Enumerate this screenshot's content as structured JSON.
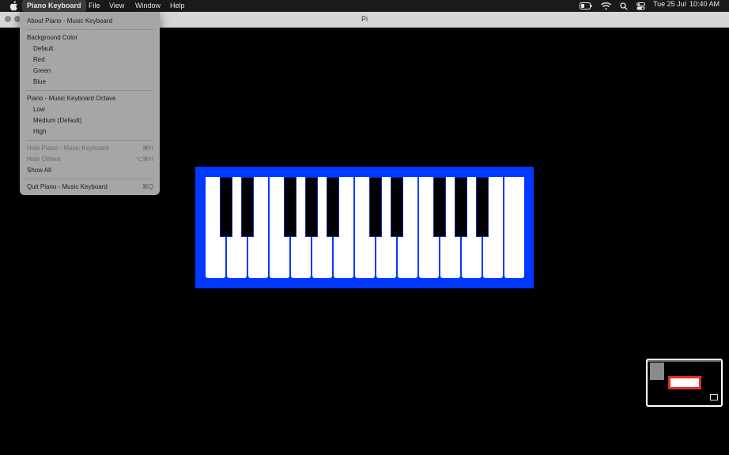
{
  "menubar": {
    "app_name": "Piano Keyboard",
    "items": [
      "File",
      "View",
      "Window",
      "Help"
    ],
    "date": "Tue 25 Jul",
    "time": "10:40 AM"
  },
  "window": {
    "title": "Pi"
  },
  "app_menu": {
    "about": "About Piano - Music Keyboard",
    "bg_header": "Background Color",
    "bg_options": [
      "Default",
      "Red",
      "Green",
      "Blue"
    ],
    "octave_header": "Piano - Music Keyboard Octave",
    "octave_options": [
      "Low",
      "Medium (Default)",
      "High"
    ],
    "hide_app": "Hide Piano - Music Keyboard",
    "hide_app_shortcut": "⌘H",
    "hide_others": "Hide Others",
    "hide_others_shortcut": "⌥⌘H",
    "show_all": "Show All",
    "quit": "Quit Piano - Music Keyboard",
    "quit_shortcut": "⌘Q"
  },
  "piano": {
    "frame_color": "#0038ff",
    "white_keys": 15,
    "black_keys": 10
  }
}
